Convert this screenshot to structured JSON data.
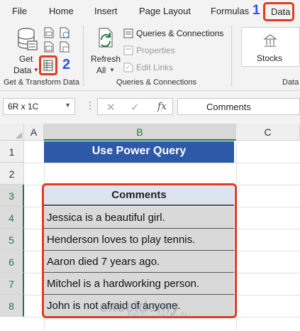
{
  "menu": {
    "tabs": [
      "File",
      "Home",
      "Insert",
      "Page Layout",
      "Formulas"
    ],
    "step1": "1",
    "active_tab": "Data"
  },
  "ribbon": {
    "get_data_line1": "Get",
    "get_data_line2": "Data",
    "step2": "2",
    "group1_label": "Get & Transform Data",
    "refresh_line1": "Refresh",
    "refresh_line2": "All",
    "queries_connections": "Queries & Connections",
    "properties": "Properties",
    "edit_links": "Edit Links",
    "group2_label": "Queries & Connections",
    "stocks": "Stocks",
    "group3_label": "Data"
  },
  "formula_bar": {
    "name_box": "6R x 1C",
    "fx": "fx",
    "content": "Comments"
  },
  "sheet": {
    "columns": [
      "A",
      "B",
      "C"
    ],
    "rows": [
      "1",
      "2",
      "3",
      "4",
      "5",
      "6",
      "7",
      "8"
    ],
    "title": "Use Power Query",
    "table_header": "Comments",
    "comments": [
      "Jessica  is a beautiful girl.",
      "Henderson loves to play tennis.",
      "Aaron died 7 years ago.",
      "Mitchel is a hardworking person.",
      "John is not afraid of anyone."
    ]
  },
  "watermark": {
    "brand": "exceldemy",
    "tagline": "EXCEL · DATA · BI"
  },
  "colors": {
    "accent_red": "#e03c22",
    "step_blue": "#2f54d6",
    "title_fill": "#2e58a8",
    "excel_green": "#217346"
  }
}
